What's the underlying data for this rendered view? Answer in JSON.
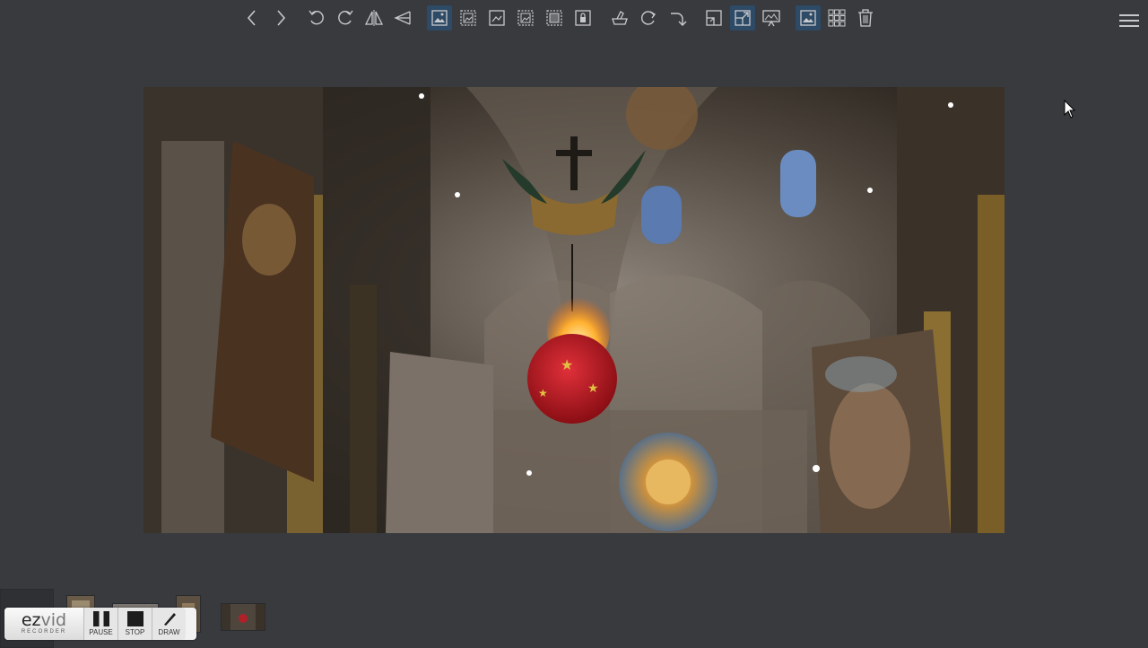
{
  "toolbar": {
    "buttons": [
      {
        "name": "previous-icon",
        "active": false
      },
      {
        "name": "next-icon",
        "active": false
      },
      {
        "name": "rotate-left-icon",
        "active": false
      },
      {
        "name": "rotate-right-icon",
        "active": false
      },
      {
        "name": "flip-horizontal-icon",
        "active": false
      },
      {
        "name": "flip-vertical-icon",
        "active": false
      },
      {
        "name": "fit-image-icon",
        "active": true
      },
      {
        "name": "fit-width-icon",
        "active": false
      },
      {
        "name": "fit-height-icon",
        "active": false
      },
      {
        "name": "actual-size-icon",
        "active": false
      },
      {
        "name": "fill-window-icon",
        "active": false
      },
      {
        "name": "lock-zoom-icon",
        "active": false
      },
      {
        "name": "clean-icon",
        "active": false
      },
      {
        "name": "refresh-icon",
        "active": false
      },
      {
        "name": "redo-icon",
        "active": false
      },
      {
        "name": "crop-icon",
        "active": false
      },
      {
        "name": "fullscreen-icon",
        "active": true
      },
      {
        "name": "slideshow-icon",
        "active": false
      },
      {
        "name": "image-view-icon",
        "active": true
      },
      {
        "name": "grid-view-icon",
        "active": false
      },
      {
        "name": "delete-icon",
        "active": false
      }
    ],
    "menu_icon": "hamburger-menu-icon"
  },
  "recorder": {
    "logo_ez": "ez",
    "logo_vid": "vid",
    "logo_sub": "RECORDER",
    "pause_label": "PAUSE",
    "stop_label": "STOP",
    "draw_label": "DRAW"
  },
  "colors": {
    "background": "#383a3e",
    "active_button": "#2d4a66",
    "icon": "#c8c9cc"
  }
}
